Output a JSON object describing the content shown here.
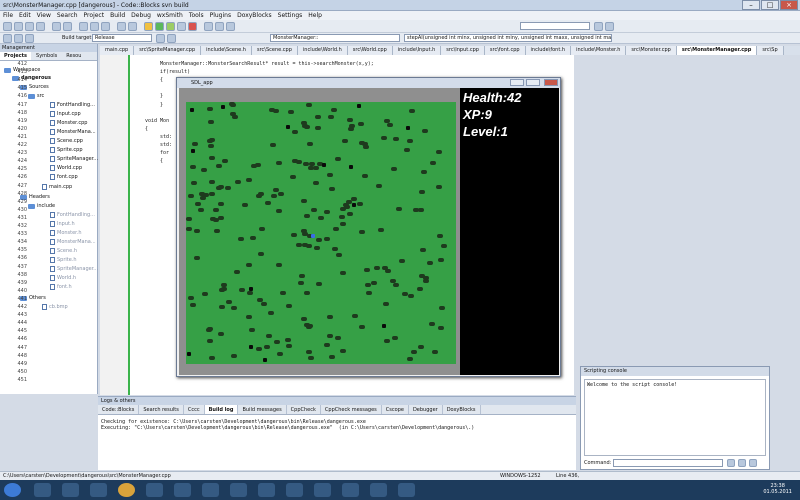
{
  "window": {
    "title": "src\\MonsterManager.cpp [dangerous] - Code::Blocks svn build"
  },
  "menu": [
    "File",
    "Edit",
    "View",
    "Search",
    "Project",
    "Build",
    "Debug",
    "wxSmith",
    "Tools",
    "Plugins",
    "DoxyBlocks",
    "Settings",
    "Help"
  ],
  "toolbar": {
    "build_target_label": "Build target:",
    "build_target_value": "Release",
    "scope": "MonsterManager::",
    "function": "stepAI(unsigned int minx, unsigned int miny, unsigned int maxx, unsigned int maxy) : void"
  },
  "tabs": [
    "main.cpp",
    "src\\SpriteManager.cpp",
    "include\\Scene.h",
    "src\\Scene.cpp",
    "include\\World.h",
    "src\\World.cpp",
    "include\\Input.h",
    "src\\Input.cpp",
    "src\\font.cpp",
    "include\\font.h",
    "include\\Monster.h",
    "src\\Monster.cpp",
    "src\\MonsterManager.cpp",
    "src\\Sp"
  ],
  "management": {
    "title": "Management",
    "tabs": [
      "Projects",
      "Symbols",
      "Resou"
    ],
    "workspace": "Workspace",
    "project": "dangerous",
    "sources": "Sources",
    "src": "src",
    "src_files": [
      "FontHandling...",
      "Input.cpp",
      "Monster.cpp",
      "MonsterMana...",
      "Scene.cpp",
      "Sprite.cpp",
      "SpriteManager...",
      "World.cpp",
      "font.cpp"
    ],
    "main": "main.cpp",
    "headers": "Headers",
    "include": "include",
    "include_files": [
      "FontHandling...",
      "Input.h",
      "Monster.h",
      "MonsterMana...",
      "Scene.h",
      "Sprite.h",
      "SpriteManager...",
      "World.h",
      "font.h"
    ],
    "others": "Others",
    "others_files": [
      "cb.bmp"
    ]
  },
  "editor": {
    "lines": [
      "412",
      "413",
      "414",
      "415",
      "416",
      "417",
      "418",
      "419",
      "420",
      "421",
      "422",
      "423",
      "424",
      "425",
      "426",
      "427",
      "428",
      "429",
      "430",
      "431",
      "432",
      "433",
      "434",
      "435",
      "436",
      "437",
      "438",
      "439",
      "440",
      "441",
      "442",
      "443",
      "444",
      "445",
      "446",
      "447",
      "448",
      "449",
      "450",
      "451"
    ],
    "code": [
      "MonsterManager::MonsterSearchResult* result = this->searchMonster(x,y);",
      "if(result)",
      "{",
      "",
      "}",
      "}",
      "",
      "void Mon",
      "{",
      "std:",
      "std:",
      "for",
      "{"
    ]
  },
  "sdl": {
    "title": "SDL_app",
    "health": "Health:42",
    "xp": "XP:9",
    "level": "Level:1"
  },
  "logs": {
    "title": "Logs & others",
    "tabs": [
      "Code::Blocks",
      "Search results",
      "Cccc",
      "Build log",
      "Build messages",
      "CppCheck",
      "CppCheck messages",
      "Cscope",
      "Debugger",
      "DoxyBlocks"
    ],
    "active_tab": "Build log",
    "line1": "Checking for existence: C:\\Users\\carsten\\Development\\dangerous\\bin\\Release\\dangerous.exe",
    "line2": "Executing: \"C:\\Users\\carsten\\Development\\dangerous\\bin\\Release\\dangerous.exe\"  (in C:\\Users\\carsten\\Development\\dangerous\\.)"
  },
  "script": {
    "title": "Scripting console",
    "welcome": "Welcome to the script console!",
    "command_label": "Command:"
  },
  "status": {
    "path": "C:\\Users\\carsten\\Development\\dangerous\\src\\MonsterManager.cpp",
    "encoding": "WINDOWS-1252",
    "position": "Line 436,"
  },
  "clock": {
    "time": "23:38",
    "date": "01.05.2011"
  },
  "colors": {
    "grass": "#36a046",
    "accent": "#3cb44b"
  }
}
